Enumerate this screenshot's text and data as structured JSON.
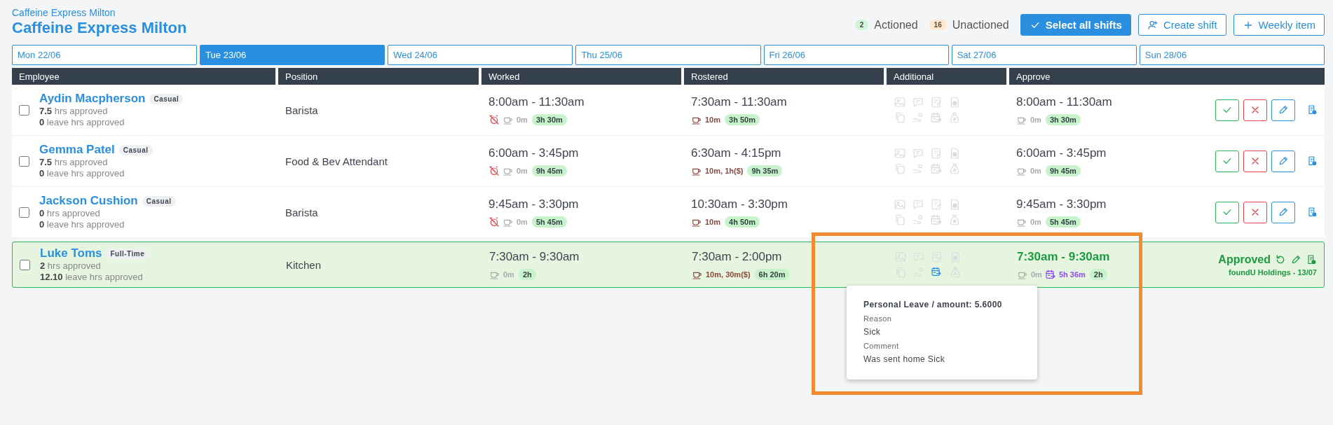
{
  "caption": "Caffeine Express Milton",
  "title": "Caffeine Express Milton",
  "counters": [
    {
      "kind": "actioned",
      "count": "2",
      "label": "Actioned"
    },
    {
      "kind": "unactioned",
      "count": "16",
      "label": "Unactioned"
    }
  ],
  "buttons": [
    {
      "kind": "select",
      "label": "Select all shifts"
    },
    {
      "kind": "create",
      "label": "Create shift"
    },
    {
      "kind": "weekly",
      "label": "Weekly item"
    }
  ],
  "days": [
    {
      "label": "Mon 22/06",
      "selected": false
    },
    {
      "label": "Tue 23/06",
      "selected": true
    },
    {
      "label": "Wed 24/06",
      "selected": false
    },
    {
      "label": "Thu 25/06",
      "selected": false
    },
    {
      "label": "Fri 26/06",
      "selected": false
    },
    {
      "label": "Sat 27/06",
      "selected": false
    },
    {
      "label": "Sun 28/06",
      "selected": false
    }
  ],
  "columns": [
    "Employee",
    "Position",
    "Worked",
    "Rostered",
    "Additional",
    "Approve"
  ],
  "rows": [
    {
      "name": "Aydin Macpherson",
      "employment": "Casual",
      "hours": "7.5",
      "hours_label": "hrs approved",
      "leave_hours": "0",
      "leave_label": "leave hrs approved",
      "checked": false,
      "position": "Barista",
      "worked": {
        "time": "8:00am - 11:30am",
        "missed_clock": true,
        "break": "0m",
        "total": "3h 30m"
      },
      "rostered": {
        "time": "7:30am - 11:30am",
        "break": "10m",
        "total": "3h 50m"
      },
      "leave_icon_active": false,
      "approve": {
        "time": "8:00am - 11:30am",
        "break": "0m",
        "total": "3h 30m"
      },
      "approved": false
    },
    {
      "name": "Gemma Patel",
      "employment": "Casual",
      "hours": "7.5",
      "hours_label": "hrs approved",
      "leave_hours": "0",
      "leave_label": "leave hrs approved",
      "checked": false,
      "position": "Food & Bev Attendant",
      "worked": {
        "time": "6:00am - 3:45pm",
        "missed_clock": true,
        "break": "0m",
        "total": "9h 45m"
      },
      "rostered": {
        "time": "6:30am - 4:15pm",
        "break": "10m, 1h($)",
        "total": "9h 35m"
      },
      "leave_icon_active": false,
      "approve": {
        "time": "6:00am - 3:45pm",
        "break": "0m",
        "total": "9h 45m"
      },
      "approved": false
    },
    {
      "name": "Jackson Cushion",
      "employment": "Casual",
      "hours": "0",
      "hours_label": "hrs approved",
      "leave_hours": "0",
      "leave_label": "leave hrs approved",
      "checked": false,
      "position": "Barista",
      "worked": {
        "time": "9:45am - 3:30pm",
        "missed_clock": true,
        "break": "0m",
        "total": "5h 45m"
      },
      "rostered": {
        "time": "10:30am - 3:30pm",
        "break": "10m",
        "total": "4h 50m"
      },
      "leave_icon_active": false,
      "approve": {
        "time": "9:45am - 3:30pm",
        "break": "0m",
        "total": "5h 45m"
      },
      "approved": false
    },
    {
      "name": "Luke Toms",
      "employment": "Full-Time",
      "hours": "2",
      "hours_label": "hrs approved",
      "leave_hours": "12.10",
      "leave_label": "leave hrs approved",
      "checked": false,
      "position": "Kitchen",
      "worked": {
        "time": "7:30am - 9:30am",
        "missed_clock": false,
        "break": "0m",
        "total": "2h"
      },
      "rostered": {
        "time": "7:30am - 2:00pm",
        "break": "10m, 30m($)",
        "total": "6h 20m"
      },
      "leave_icon_active": true,
      "approve": {
        "time": "7:30am - 9:30am",
        "break": "0m",
        "leave": "5h 36m",
        "total": "2h"
      },
      "approved": true,
      "status_label": "Approved",
      "approved_by": "foundU Holdings - 13/07"
    }
  ],
  "tooltip": {
    "title": "Personal Leave / amount: 5.6000",
    "fields": [
      {
        "label": "Reason",
        "value": "Sick"
      },
      {
        "label": "Comment",
        "value": "Was sent home Sick"
      }
    ]
  },
  "highlight_frame": true
}
